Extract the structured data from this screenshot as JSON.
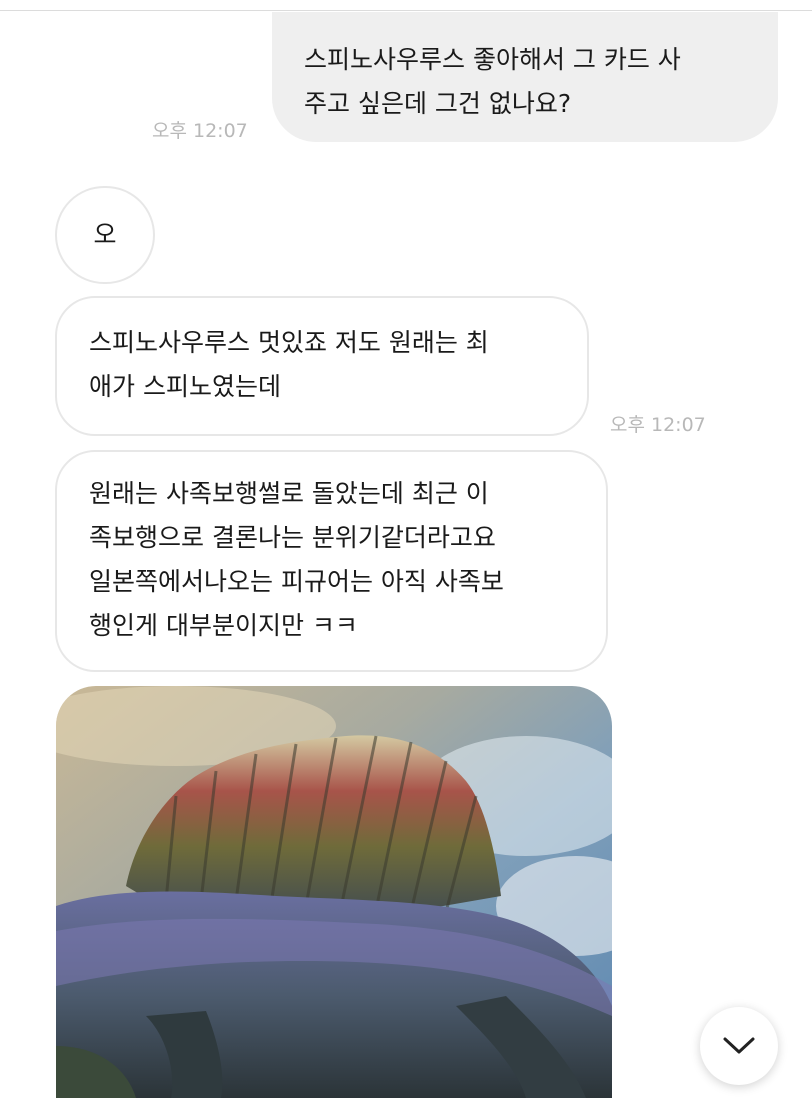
{
  "conversation": {
    "messages": [
      {
        "id": "m1",
        "sender": "me",
        "text": "스피노사우루스 좋아해서 그 카드 사\n주고 싶은데 그건 없나요?",
        "time": "오후 12:07"
      },
      {
        "id": "m2",
        "sender": "other",
        "text": "오"
      },
      {
        "id": "m3",
        "sender": "other",
        "text": "스피노사우루스 멋있죠 저도 원래는 최\n애가 스피노였는데",
        "time": "오후 12:07"
      },
      {
        "id": "m4",
        "sender": "other",
        "text": "원래는 사족보행썰로 돌았는데 최근 이\n족보행으로 결론나는 분위기같더라고요\n일본쪽에서나오는 피규어는 아직 사족보\n행인게 대부분이지만 ㅋㅋ"
      }
    ],
    "attachment": {
      "type": "image",
      "icon": "spinosaurus-image"
    }
  },
  "controls": {
    "scroll_down_icon": "chevron-down-icon"
  },
  "colors": {
    "sent_bubble": "#efefef",
    "received_border": "#e7e7e7",
    "timestamp": "#b8b8b8",
    "text": "#1a1a1a"
  }
}
